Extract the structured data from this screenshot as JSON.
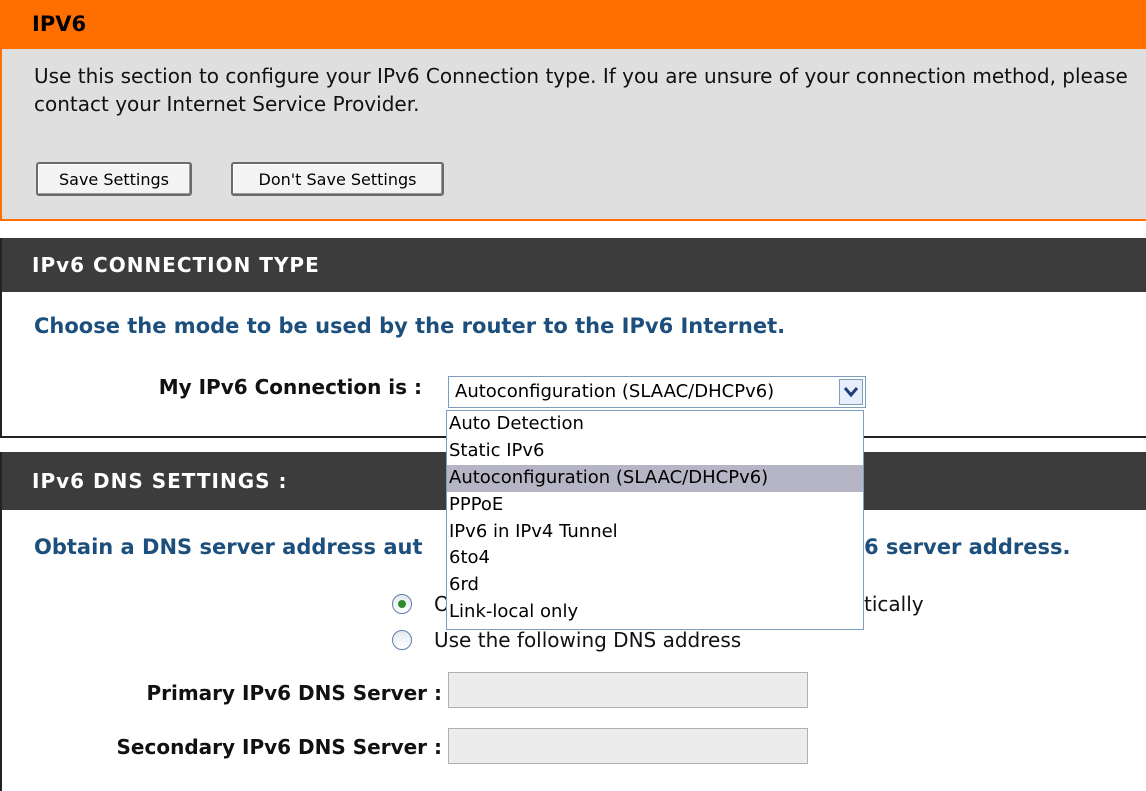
{
  "ipv6_section": {
    "title": "IPV6",
    "description": "Use this section to configure your IPv6 Connection type. If you are unsure of your connection method, please contact your Internet Service Provider.",
    "save_label": "Save Settings",
    "dont_save_label": "Don't Save Settings"
  },
  "connection_type": {
    "title": "IPv6 CONNECTION TYPE",
    "heading": "Choose the mode to be used by the router to the IPv6 Internet.",
    "label": "My IPv6 Connection is :",
    "selected": "Autoconfiguration (SLAAC/DHCPv6)",
    "options": [
      "Auto Detection",
      "Static IPv6",
      "Autoconfiguration (SLAAC/DHCPv6)",
      "PPPoE",
      "IPv6 in IPv4 Tunnel",
      "6to4",
      "6rd",
      "Link-local only"
    ]
  },
  "dns_settings": {
    "title": "IPv6 DNS SETTINGS :",
    "heading_visible_left": "Obtain a DNS server address aut",
    "heading_visible_right": "6 server address.",
    "radio_auto_visible_left": "O",
    "radio_auto_visible_right": "tically",
    "radio_auto_checked": true,
    "radio_manual_label": "Use the following DNS address",
    "primary_label": "Primary IPv6 DNS Server :",
    "primary_value": "",
    "secondary_label": "Secondary IPv6 DNS Server :",
    "secondary_value": ""
  },
  "colors": {
    "orange": "#ff6f00",
    "dark_bar": "#3c3c3c",
    "heading_blue": "#1d4f7d"
  }
}
